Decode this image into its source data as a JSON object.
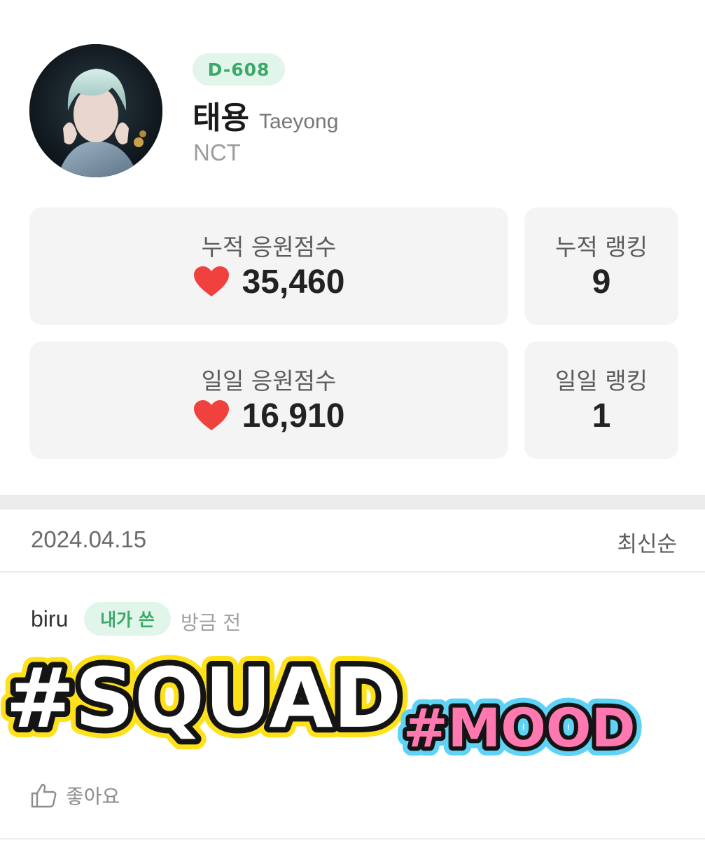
{
  "profile": {
    "dday": "D-608",
    "name_ko": "태용",
    "name_en": "Taeyong",
    "group": "NCT"
  },
  "stats": {
    "total_score_label": "누적 응원점수",
    "total_score_value": "35,460",
    "total_rank_label": "누적 랭킹",
    "total_rank_value": "9",
    "daily_score_label": "일일 응원점수",
    "daily_score_value": "16,910",
    "daily_rank_label": "일일 랭킹",
    "daily_rank_value": "1",
    "heart_icon": "heart-icon",
    "heart_color": "#f0413f"
  },
  "feed": {
    "date": "2024.04.15",
    "sort_label": "최신순"
  },
  "comment": {
    "author": "biru",
    "badge": "내가 쓴",
    "time": "방금 전",
    "like_label": "좋아요",
    "like_icon": "thumbs-up-icon"
  },
  "sticker": {
    "text_1": "#SQUAD",
    "text_2": "#MOOD"
  },
  "colors": {
    "accent_green": "#3ca86a",
    "badge_bg": "#e2f5ea",
    "card_bg": "#f4f4f4",
    "sticker_yellow": "#ffe11a",
    "sticker_pink": "#ff79b0",
    "sticker_blue": "#5fd3f5"
  }
}
